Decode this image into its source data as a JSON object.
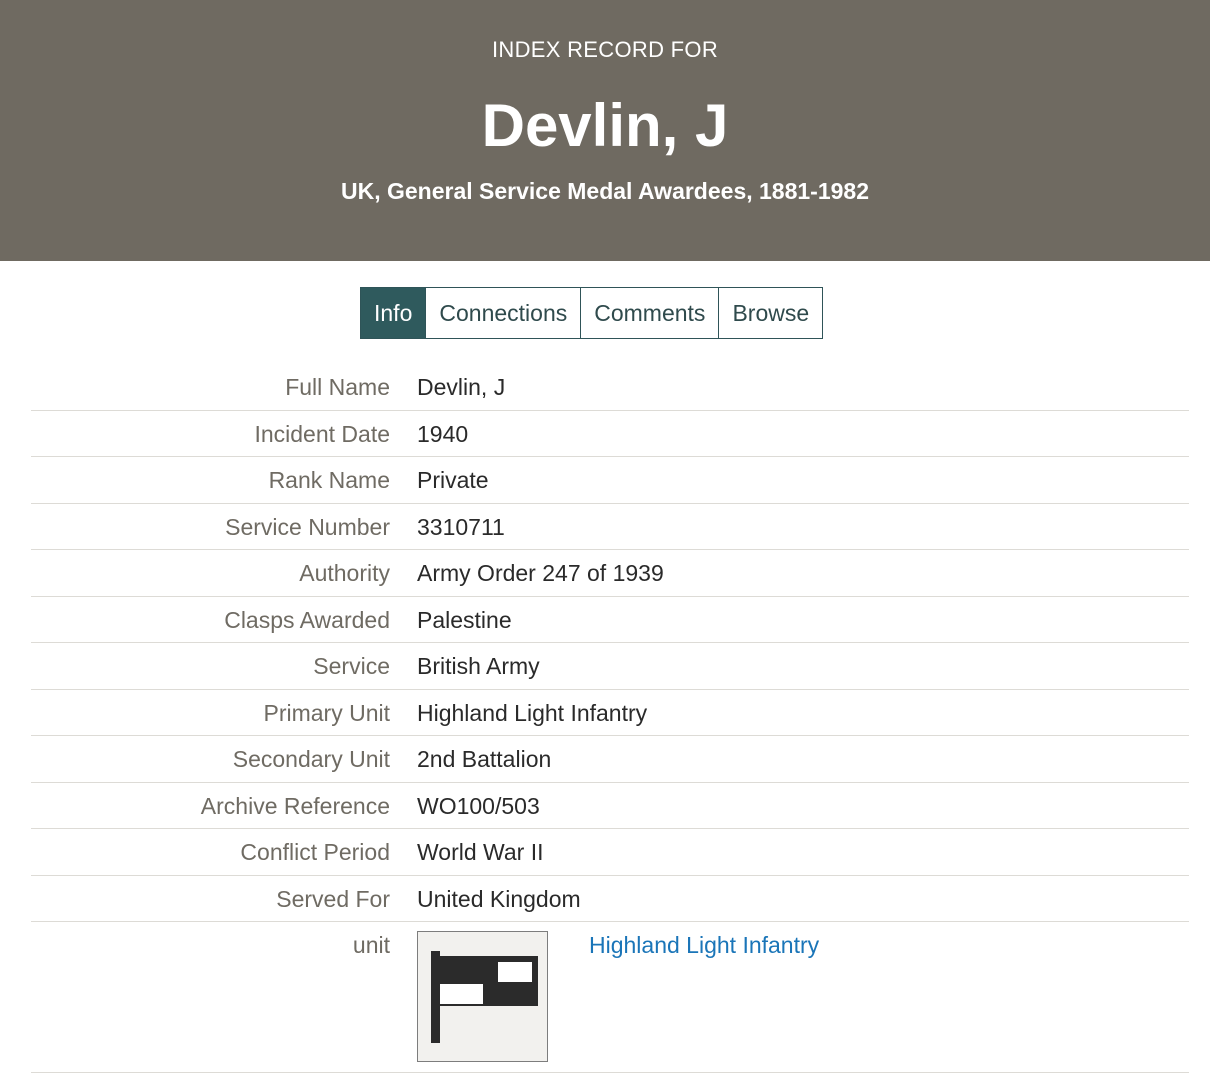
{
  "header": {
    "eyebrow": "INDEX RECORD FOR",
    "title": "Devlin, J",
    "subtitle": "UK, General Service Medal Awardees, 1881-1982"
  },
  "tabs": [
    {
      "label": "Info",
      "active": true
    },
    {
      "label": "Connections",
      "active": false
    },
    {
      "label": "Comments",
      "active": false
    },
    {
      "label": "Browse",
      "active": false
    }
  ],
  "fields": [
    {
      "label": "Full Name",
      "value": "Devlin, J"
    },
    {
      "label": "Incident Date",
      "value": "1940"
    },
    {
      "label": "Rank Name",
      "value": "Private"
    },
    {
      "label": "Service Number",
      "value": "3310711"
    },
    {
      "label": "Authority",
      "value": "Army Order 247 of 1939"
    },
    {
      "label": "Clasps Awarded",
      "value": "Palestine"
    },
    {
      "label": "Service",
      "value": "British Army"
    },
    {
      "label": "Primary Unit",
      "value": "Highland Light Infantry"
    },
    {
      "label": "Secondary Unit",
      "value": "2nd Battalion"
    },
    {
      "label": "Archive Reference",
      "value": "WO100/503"
    },
    {
      "label": "Conflict Period",
      "value": "World War II"
    },
    {
      "label": "Served For",
      "value": "United Kingdom"
    }
  ],
  "unit": {
    "label": "unit",
    "link_text": "Highland Light Infantry",
    "icon": "flag-icon"
  },
  "colors": {
    "header_bg": "#6f6a61",
    "tab_active_bg": "#2f5a5d",
    "link": "#1a75b8"
  }
}
